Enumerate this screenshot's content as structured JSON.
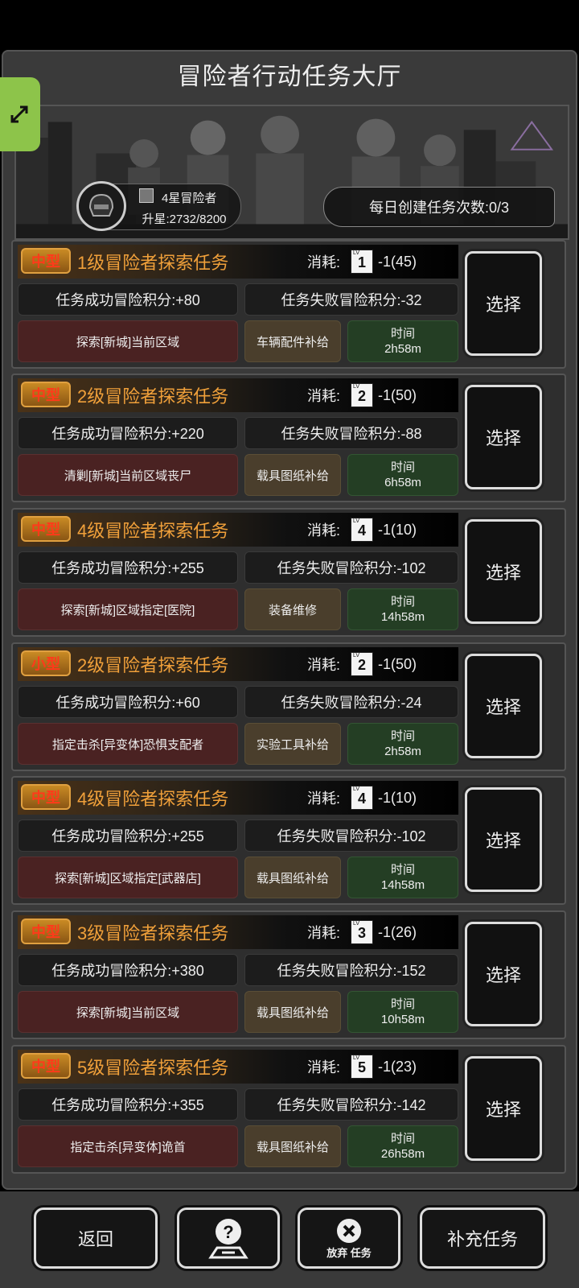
{
  "header": {
    "title": "冒险者行动任务大厅"
  },
  "banner": {
    "rank_label": "4星冒险者",
    "upgrade_progress": "升星:2732/8200",
    "daily_create": "每日创建任务次数:0/3"
  },
  "tasks": [
    {
      "size": "中型",
      "name": "1级冒险者探索任务",
      "cost_label": "消耗:",
      "lv": "1",
      "cost": "-1(45)",
      "success": "任务成功冒险积分:+80",
      "fail": "任务失败冒险积分:-32",
      "goal": "探索[新城]当前区域",
      "reward": "车辆配件补给",
      "time_label": "时间",
      "time": "2h58m",
      "select": "选择"
    },
    {
      "size": "中型",
      "name": "2级冒险者探索任务",
      "cost_label": "消耗:",
      "lv": "2",
      "cost": "-1(50)",
      "success": "任务成功冒险积分:+220",
      "fail": "任务失败冒险积分:-88",
      "goal": "清剿[新城]当前区域丧尸",
      "reward": "载具图纸补给",
      "time_label": "时间",
      "time": "6h58m",
      "select": "选择"
    },
    {
      "size": "中型",
      "name": "4级冒险者探索任务",
      "cost_label": "消耗:",
      "lv": "4",
      "cost": "-1(10)",
      "success": "任务成功冒险积分:+255",
      "fail": "任务失败冒险积分:-102",
      "goal": "探索[新城]区域指定[医院]",
      "reward": "装备维修",
      "time_label": "时间",
      "time": "14h58m",
      "select": "选择"
    },
    {
      "size": "小型",
      "name": "2级冒险者探索任务",
      "cost_label": "消耗:",
      "lv": "2",
      "cost": "-1(50)",
      "success": "任务成功冒险积分:+60",
      "fail": "任务失败冒险积分:-24",
      "goal": "指定击杀[异变体]恐惧支配者",
      "reward": "实验工具补给",
      "time_label": "时间",
      "time": "2h58m",
      "select": "选择"
    },
    {
      "size": "中型",
      "name": "4级冒险者探索任务",
      "cost_label": "消耗:",
      "lv": "4",
      "cost": "-1(10)",
      "success": "任务成功冒险积分:+255",
      "fail": "任务失败冒险积分:-102",
      "goal": "探索[新城]区域指定[武器店]",
      "reward": "载具图纸补给",
      "time_label": "时间",
      "time": "14h58m",
      "select": "选择"
    },
    {
      "size": "中型",
      "name": "3级冒险者探索任务",
      "cost_label": "消耗:",
      "lv": "3",
      "cost": "-1(26)",
      "success": "任务成功冒险积分:+380",
      "fail": "任务失败冒险积分:-152",
      "goal": "探索[新城]当前区域",
      "reward": "载具图纸补给",
      "time_label": "时间",
      "time": "10h58m",
      "select": "选择"
    },
    {
      "size": "中型",
      "name": "5级冒险者探索任务",
      "cost_label": "消耗:",
      "lv": "5",
      "cost": "-1(23)",
      "success": "任务成功冒险积分:+355",
      "fail": "任务失败冒险积分:-142",
      "goal": "指定击杀[异变体]诡首",
      "reward": "载具图纸补给",
      "time_label": "时间",
      "time": "26h58m",
      "select": "选择"
    }
  ],
  "bottom": {
    "back": "返回",
    "abandon": "放弃 任务",
    "refill": "补充任务"
  },
  "icons": {
    "expand": "expand-arrows-icon",
    "help": "question-map-icon",
    "abandon": "close-circle-icon",
    "helmet": "helmet-avatar-icon"
  },
  "colors": {
    "task_name": "#f0a03a",
    "size_badge_text": "#ff3a1a",
    "expand_button": "#8dc44a",
    "goal_bg": "#4a2222",
    "reward_bg": "#4a3e2c",
    "time_bg": "#243e24"
  }
}
